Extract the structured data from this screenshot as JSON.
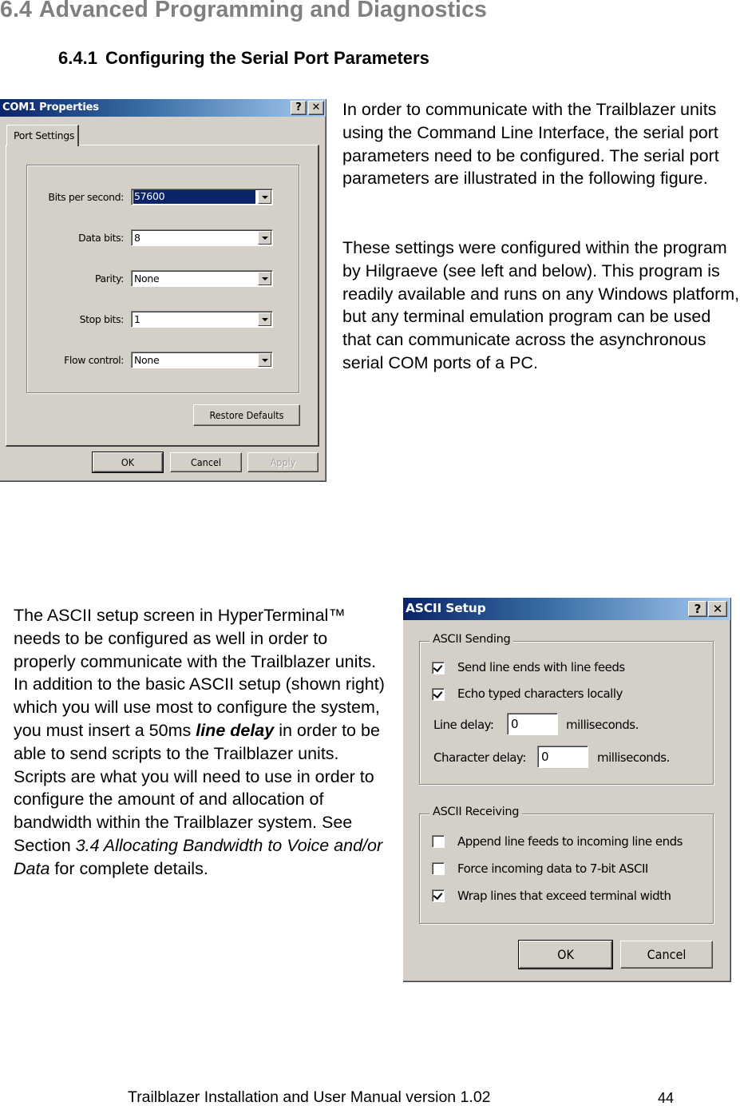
{
  "section": {
    "number": "6.4",
    "title": "Advanced Programming and Diagnostics"
  },
  "subsection": {
    "number": "6.4.1",
    "title": "Configuring the Serial Port Parameters"
  },
  "paragraphs": {
    "p1": "In order to communicate with the Trailblazer units using the Command Line Interface, the serial port parameters need to be configured. The serial port parameters are illustrated in the following figure.",
    "p2": "These settings were configured within the program by Hilgraeve (see left and below). This program is readily available and runs on any Windows platform, but any terminal emulation program can be used that can communicate across the asynchronous serial COM ports of a PC.",
    "p3": {
      "before": "The ASCII setup screen in HyperTerminal™ needs to be configured as well in order to properly communicate with the Trailblazer units. In addition to the basic ASCII setup (shown right) which you will use most to configure the system, you must insert a 50ms ",
      "emphasis": "line delay",
      "middle": " in order to be able to send scripts to the Trailblazer units. Scripts are what you will need to use in order to configure the amount of and allocation of bandwidth within the Trailblazer system. See Section ",
      "reference": "3.4 Allocating Bandwidth to Voice and/or Data",
      "after": " for complete details."
    }
  },
  "com1_dialog": {
    "title": "COM1 Properties",
    "help_button": "?",
    "close_button": "✕",
    "tab": "Port Settings",
    "fields": [
      {
        "label": "Bits per second:",
        "value": "57600",
        "selected": true
      },
      {
        "label": "Data bits:",
        "value": "8"
      },
      {
        "label": "Parity:",
        "value": "None"
      },
      {
        "label": "Stop bits:",
        "value": "1"
      },
      {
        "label": "Flow control:",
        "value": "None"
      }
    ],
    "restore_defaults": "Restore Defaults",
    "ok": "OK",
    "cancel": "Cancel",
    "apply": "Apply"
  },
  "ascii_dialog": {
    "title": "ASCII Setup",
    "help_button": "?",
    "close_button": "✕",
    "sending_group": "ASCII Sending",
    "sending_options": [
      {
        "label": "Send line ends with line feeds",
        "checked": true
      },
      {
        "label": "Echo typed characters locally",
        "checked": true
      }
    ],
    "line_delay_label": "Line delay:",
    "line_delay_value": "0",
    "line_delay_unit": "milliseconds.",
    "char_delay_label": "Character delay:",
    "char_delay_value": "0",
    "char_delay_unit": "milliseconds.",
    "receiving_group": "ASCII Receiving",
    "receiving_options": [
      {
        "label": "Append line feeds to incoming line ends",
        "checked": false
      },
      {
        "label": "Force incoming data to 7-bit ASCII",
        "checked": false
      },
      {
        "label": "Wrap lines that exceed terminal width",
        "checked": true
      }
    ],
    "ok": "OK",
    "cancel": "Cancel"
  },
  "footer": {
    "title": "Trailblazer Installation and User Manual version 1.02",
    "page": "44"
  }
}
